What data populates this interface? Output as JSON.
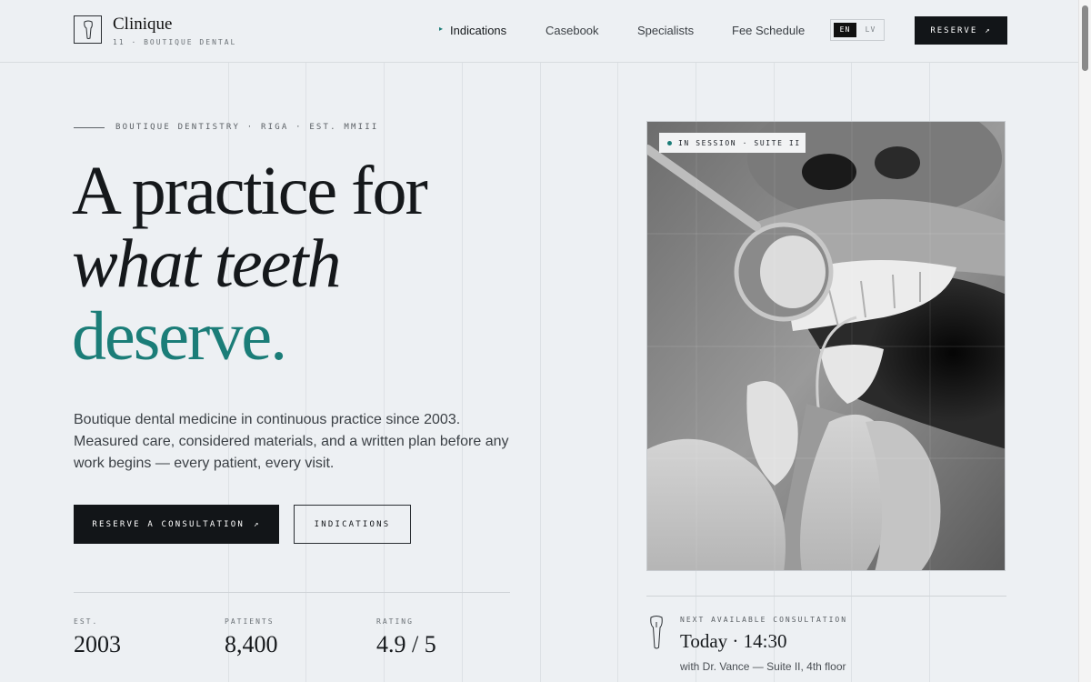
{
  "brand": {
    "name": "Clinique",
    "subtitle": "11 · BOUTIQUE DENTAL"
  },
  "nav": {
    "items": [
      {
        "label": "Indications",
        "active": true
      },
      {
        "label": "Casebook",
        "active": false
      },
      {
        "label": "Specialists",
        "active": false
      },
      {
        "label": "Fee Schedule",
        "active": false
      }
    ],
    "lang_options": [
      "EN",
      "LV"
    ],
    "lang_selected": "EN",
    "reserve_label": "RESERVE",
    "reserve_arrow": "↗"
  },
  "hero": {
    "eyebrow": "BOUTIQUE DENTISTRY · RIGA · EST. MMIII",
    "headline_line1": "A practice for",
    "headline_line2": "what teeth",
    "headline_line3": "deserve.",
    "lede": "Boutique dental medicine in continuous practice since 2003. Measured care, considered materials, and a written plan before any work begins — every patient, every visit.",
    "primary_cta": "RESERVE A CONSULTATION",
    "primary_cta_arrow": "↗",
    "secondary_cta": "INDICATIONS"
  },
  "stats": [
    {
      "label": "EST.",
      "value": "2003"
    },
    {
      "label": "PATIENTS",
      "value": "8,400"
    },
    {
      "label": "RATING",
      "value": "4.9 / 5"
    }
  ],
  "photo": {
    "badge": "IN SESSION · SUITE II"
  },
  "next_consultation": {
    "label": "NEXT AVAILABLE CONSULTATION",
    "time": "Today · 14:30",
    "detail": "with Dr. Vance — Suite II, 4th floor"
  },
  "colors": {
    "accent": "#1b7d78",
    "ink": "#15181b",
    "background": "#edf0f3",
    "button_dark": "#121518"
  },
  "icons": [
    "tooth-icon",
    "arrow-up-right-icon",
    "dot-icon"
  ]
}
